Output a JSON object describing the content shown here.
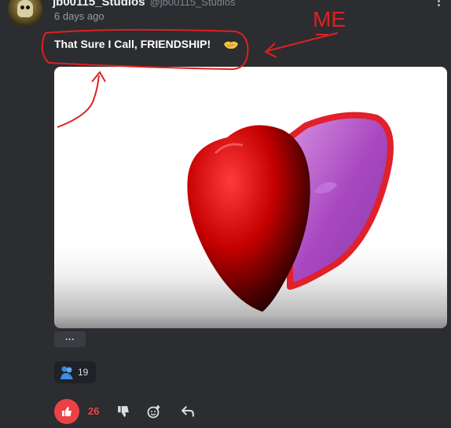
{
  "post": {
    "username": "jb00115_Studios",
    "handle": "@jb00115_Studios",
    "timestamp": "6 days ago",
    "message": "That Sure I Call, FRIENDSHIP!",
    "emoji": "handshake-emoji"
  },
  "media": {
    "description_icon": "heart-locket-3d",
    "more_label": "···"
  },
  "reactions": [
    {
      "icon": "hug-emoji",
      "count": "19"
    }
  ],
  "actions": {
    "like_count": "26",
    "like_color": "#ed4245"
  },
  "annotation": {
    "text": "ME",
    "color": "#e02020"
  }
}
